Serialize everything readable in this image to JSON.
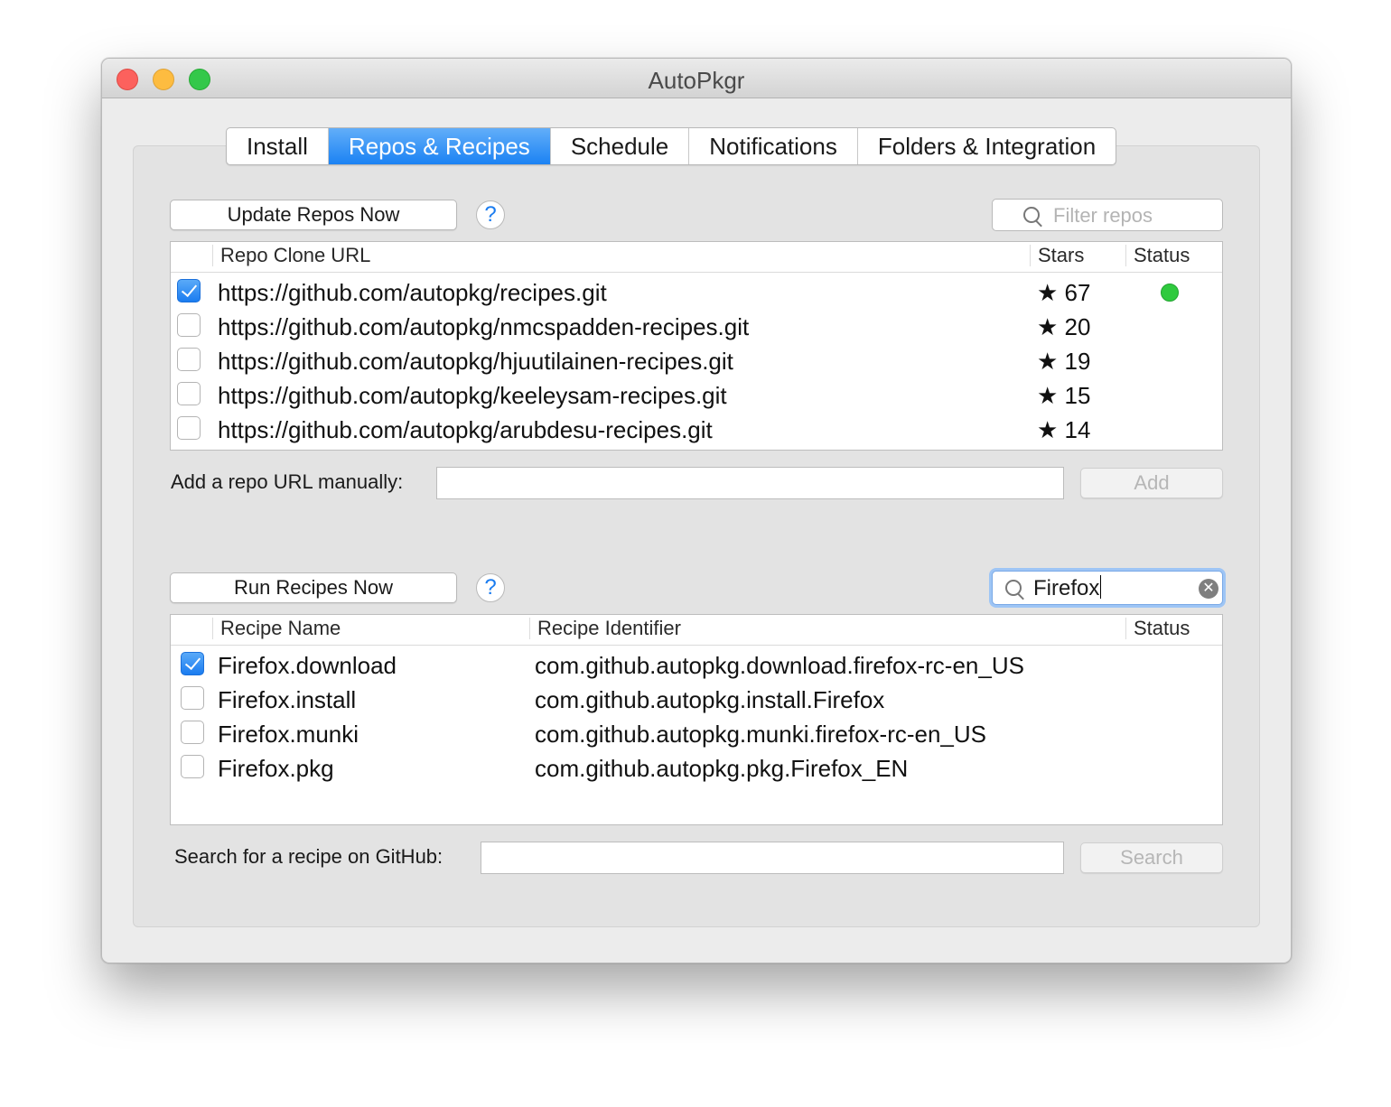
{
  "window": {
    "title": "AutoPkgr"
  },
  "tabs": [
    {
      "label": "Install",
      "active": false
    },
    {
      "label": "Repos & Recipes",
      "active": true
    },
    {
      "label": "Schedule",
      "active": false
    },
    {
      "label": "Notifications",
      "active": false
    },
    {
      "label": "Folders & Integration",
      "active": false
    }
  ],
  "repos": {
    "update_button": "Update Repos Now",
    "help": "?",
    "filter_placeholder": "Filter repos",
    "columns": {
      "url": "Repo Clone URL",
      "stars": "Stars",
      "status": "Status"
    },
    "star_glyph": "★",
    "rows": [
      {
        "checked": true,
        "url": "https://github.com/autopkg/recipes.git",
        "stars": "67",
        "status": "green"
      },
      {
        "checked": false,
        "url": "https://github.com/autopkg/nmcspadden-recipes.git",
        "stars": "20",
        "status": ""
      },
      {
        "checked": false,
        "url": "https://github.com/autopkg/hjuutilainen-recipes.git",
        "stars": "19",
        "status": ""
      },
      {
        "checked": false,
        "url": "https://github.com/autopkg/keeleysam-recipes.git",
        "stars": "15",
        "status": ""
      },
      {
        "checked": false,
        "url": "https://github.com/autopkg/arubdesu-recipes.git",
        "stars": "14",
        "status": ""
      }
    ],
    "manual_label": "Add a repo URL manually:",
    "manual_value": "",
    "add_button": "Add"
  },
  "recipes": {
    "run_button": "Run Recipes Now",
    "help": "?",
    "filter_value": "Firefox",
    "columns": {
      "name": "Recipe Name",
      "identifier": "Recipe Identifier",
      "status": "Status"
    },
    "rows": [
      {
        "checked": true,
        "name": "Firefox.download",
        "identifier": "com.github.autopkg.download.firefox-rc-en_US"
      },
      {
        "checked": false,
        "name": "Firefox.install",
        "identifier": "com.github.autopkg.install.Firefox"
      },
      {
        "checked": false,
        "name": "Firefox.munki",
        "identifier": "com.github.autopkg.munki.firefox-rc-en_US"
      },
      {
        "checked": false,
        "name": "Firefox.pkg",
        "identifier": "com.github.autopkg.pkg.Firefox_EN"
      }
    ],
    "github_search_label": "Search for a recipe on GitHub:",
    "github_search_value": "",
    "search_button": "Search"
  },
  "colors": {
    "accent": "#1a7cf0",
    "status_ok": "#2fca3e",
    "close": "#fc615d",
    "minimize": "#fdbc40",
    "maximize": "#34c84a"
  }
}
